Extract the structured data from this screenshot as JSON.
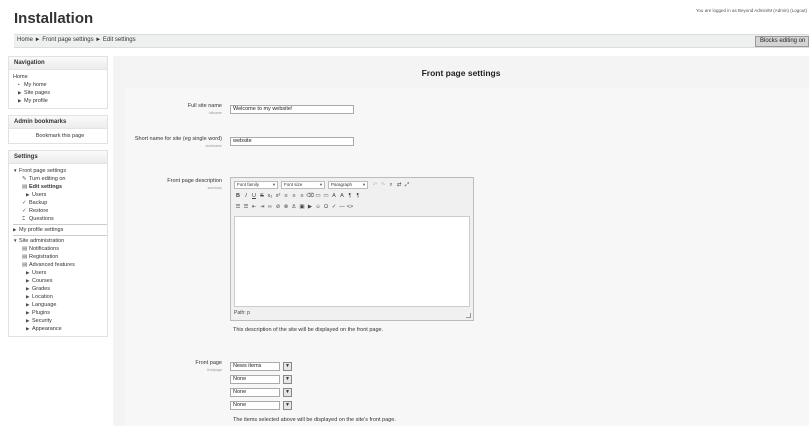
{
  "header": {
    "site_title": "Installation",
    "login_info": "You are logged in as Beyond Admin/M (Admin) (Logout)"
  },
  "navbar": {
    "breadcrumb": "Home ► Front page settings ► Edit settings",
    "blocks_button": "Blocks editing on"
  },
  "sidebar": {
    "navigation": {
      "title": "Navigation",
      "items": [
        "Home",
        "My home",
        "Site pages",
        "My profile"
      ]
    },
    "admin_bookmarks": {
      "title": "Admin bookmarks",
      "items": [
        "Bookmark this page"
      ]
    },
    "settings": {
      "title": "Settings",
      "front_page_settings": "Front page settings",
      "fp_items": [
        "Turn editing on",
        "Edit settings",
        "Users",
        "Backup",
        "Restore",
        "Questions"
      ],
      "my_profile_settings": "My profile settings",
      "site_administration": "Site administration",
      "admin_items": [
        "Notifications",
        "Registration",
        "Advanced features"
      ],
      "admin_folders": [
        "Users",
        "Courses",
        "Grades",
        "Location",
        "Language",
        "Plugins",
        "Security",
        "Appearance"
      ]
    }
  },
  "main": {
    "heading": "Front page settings",
    "full_site_name": {
      "label": "Full site name",
      "sub": "fullname",
      "value": "Welcome to my website!"
    },
    "short_name": {
      "label": "Short name for site (eg single word)",
      "sub": "shortname",
      "value": "website"
    },
    "description": {
      "label": "Front page description",
      "sub": "summary",
      "font_family": "Font family",
      "font_size": "Font size",
      "paragraph": "Paragraph",
      "path": "Path: p",
      "help": "This description of the site will be displayed on the front page."
    },
    "front_page": {
      "label": "Front page",
      "sub": "frontpage",
      "options": [
        "News items",
        "None",
        "None",
        "None"
      ],
      "help": "The items selected above will be displayed on the site's front page."
    }
  }
}
